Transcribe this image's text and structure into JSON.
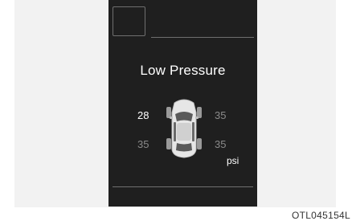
{
  "display": {
    "title": "Low Pressure",
    "unit": "psi",
    "tires": {
      "front_left": "28",
      "front_right": "35",
      "rear_left": "35",
      "rear_right": "35"
    },
    "low_tire": "front_left"
  },
  "caption": "OTL045154L",
  "colors": {
    "display_background": "#1f1f1f",
    "alert_value": "#ffffff",
    "normal_value": "#8a8a8a",
    "frame_lines": "#6f6f6f"
  },
  "icons": [
    "car-top-view-icon"
  ]
}
